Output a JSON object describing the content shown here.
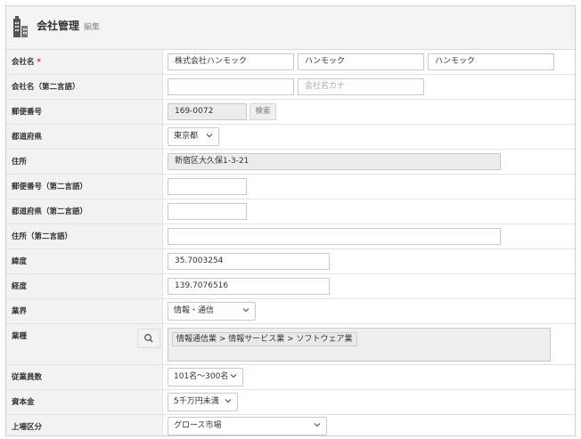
{
  "header": {
    "title": "会社管理",
    "subtitle": "編集"
  },
  "rows": {
    "company_name": {
      "label": "会社名",
      "required_mark": "*",
      "values": [
        "株式会社ハンモック",
        "ハンモック",
        "ハンモック"
      ]
    },
    "company_name_alt": {
      "label": "会社名（第二言語）",
      "value": "",
      "kana_placeholder": "会社名カナ"
    },
    "postal_code": {
      "label": "郵便番号",
      "value": "169-0072",
      "search_label": "検索"
    },
    "prefecture": {
      "label": "都道府県",
      "value": "東京都"
    },
    "address": {
      "label": "住所",
      "value": "新宿区大久保1-3-21"
    },
    "postal_code_alt": {
      "label": "郵便番号（第二言語）",
      "value": ""
    },
    "prefecture_alt": {
      "label": "都道府県（第二言語）",
      "value": ""
    },
    "address_alt": {
      "label": "住所（第二言語）",
      "value": ""
    },
    "latitude": {
      "label": "緯度",
      "value": "35.7003254"
    },
    "longitude": {
      "label": "経度",
      "value": "139.7076516"
    },
    "industry": {
      "label": "業界",
      "value": "情報・通信"
    },
    "business_type": {
      "label": "業種",
      "tag": "情報通信業 > 情報サービス業 > ソフトウェア業"
    },
    "employees": {
      "label": "従業員数",
      "value": "101名〜300名"
    },
    "capital": {
      "label": "資本金",
      "value": "5千万円未満"
    },
    "listing": {
      "label": "上場区分",
      "value": "グロース市場"
    }
  },
  "icons": {
    "header": "building-icon",
    "chevron": "chevron-down-icon",
    "search": "search-icon"
  }
}
